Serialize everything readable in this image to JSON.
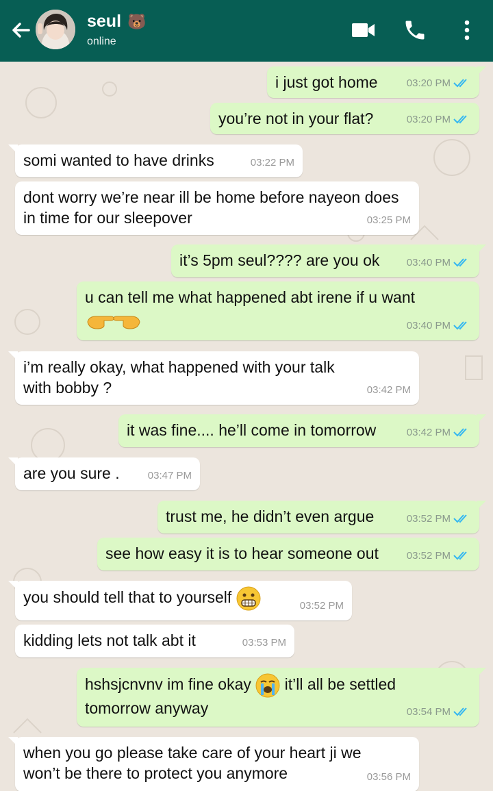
{
  "header": {
    "contact_name": "seul",
    "name_emoji": "🐻",
    "status": "online"
  },
  "colors": {
    "header_bg": "#075e54",
    "outgoing_bubble": "#dcf8c6",
    "incoming_bubble": "#ffffff",
    "read_ticks": "#34b7f1"
  },
  "messages": [
    {
      "dir": "out",
      "lines": [
        "i just got home"
      ],
      "time": "03:20 PM",
      "read": true
    },
    {
      "dir": "out",
      "lines": [
        "you’re not in your flat?"
      ],
      "time": "03:20 PM",
      "read": true
    },
    {
      "dir": "in",
      "lines": [
        "somi wanted to have drinks"
      ],
      "time": "03:22 PM"
    },
    {
      "dir": "in",
      "lines": [
        "dont worry we’re near ill be home before nayeon does",
        "in time for our sleepover"
      ],
      "time": "03:25 PM"
    },
    {
      "dir": "out",
      "lines": [
        "it’s 5pm seul???? are you ok"
      ],
      "time": "03:40 PM",
      "read": true
    },
    {
      "dir": "out",
      "lines": [
        "u can tell me what happened abt irene if u want",
        "👉👈"
      ],
      "time": "03:40 PM",
      "read": true
    },
    {
      "dir": "in",
      "lines": [
        "i’m really okay, what happened with your talk",
        "with bobby ?"
      ],
      "time": "03:42 PM"
    },
    {
      "dir": "out",
      "lines": [
        "it was fine.... he’ll come in tomorrow"
      ],
      "time": "03:42 PM",
      "read": true
    },
    {
      "dir": "in",
      "lines": [
        "are you sure ."
      ],
      "time": "03:47 PM"
    },
    {
      "dir": "out",
      "lines": [
        "trust me, he didn’t even argue"
      ],
      "time": "03:52 PM",
      "read": true
    },
    {
      "dir": "out",
      "lines": [
        "see how easy it is to hear someone out"
      ],
      "time": "03:52 PM",
      "read": true
    },
    {
      "dir": "in",
      "lines": [
        "you should tell that to yourself 😬"
      ],
      "time": "03:52 PM"
    },
    {
      "dir": "in",
      "lines": [
        "kidding lets not talk abt it"
      ],
      "time": "03:53 PM"
    },
    {
      "dir": "out",
      "lines": [
        "hshsjcnvnv im fine okay 😭 it’ll all be settled",
        "tomorrow anyway"
      ],
      "time": "03:54 PM",
      "read": true
    },
    {
      "dir": "in",
      "lines": [
        "when you go please take care of your heart ji we",
        "won’t be there to protect you anymore"
      ],
      "time": "03:56 PM"
    }
  ]
}
